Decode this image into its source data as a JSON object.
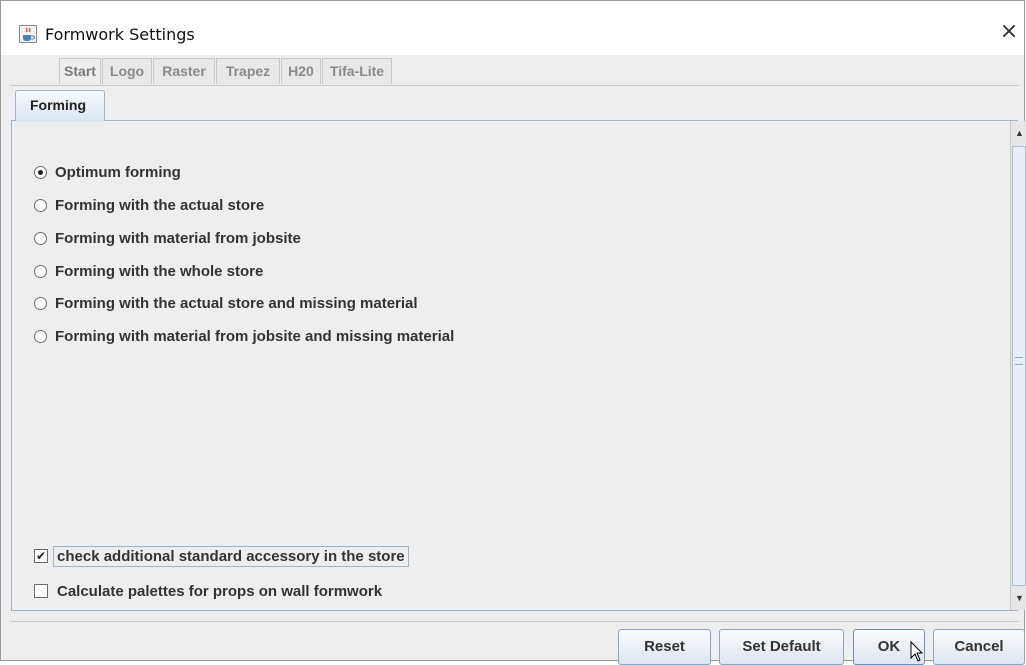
{
  "window": {
    "title": "Formwork Settings",
    "close_label": "×",
    "app_icon": "java-coffee-cup-icon"
  },
  "tabs": [
    {
      "label": "Start",
      "active": true
    },
    {
      "label": "Logo",
      "active": false
    },
    {
      "label": "Raster",
      "active": false
    },
    {
      "label": "Trapez",
      "active": false
    },
    {
      "label": "H20",
      "active": false
    },
    {
      "label": "Tifa-Lite",
      "active": false
    }
  ],
  "sub_tab": {
    "label": "Forming"
  },
  "forming_options": [
    {
      "label": "Optimum forming",
      "selected": true
    },
    {
      "label": "Forming with the actual store",
      "selected": false
    },
    {
      "label": "Forming with material from jobsite",
      "selected": false
    },
    {
      "label": "Forming with the whole store",
      "selected": false
    },
    {
      "label": "Forming with the actual store and missing material",
      "selected": false
    },
    {
      "label": "Forming with material from jobsite and missing material",
      "selected": false
    }
  ],
  "checkboxes": [
    {
      "label": "check additional standard accessory in the store",
      "checked": true
    },
    {
      "label": "Calculate palettes for props on wall formwork",
      "checked": false
    }
  ],
  "buttons": {
    "reset": "Reset",
    "set_default": "Set Default",
    "ok": "OK",
    "cancel": "Cancel"
  },
  "colors": {
    "accent_border": "#9fb4cc",
    "panel_bg": "#eeeeee"
  }
}
